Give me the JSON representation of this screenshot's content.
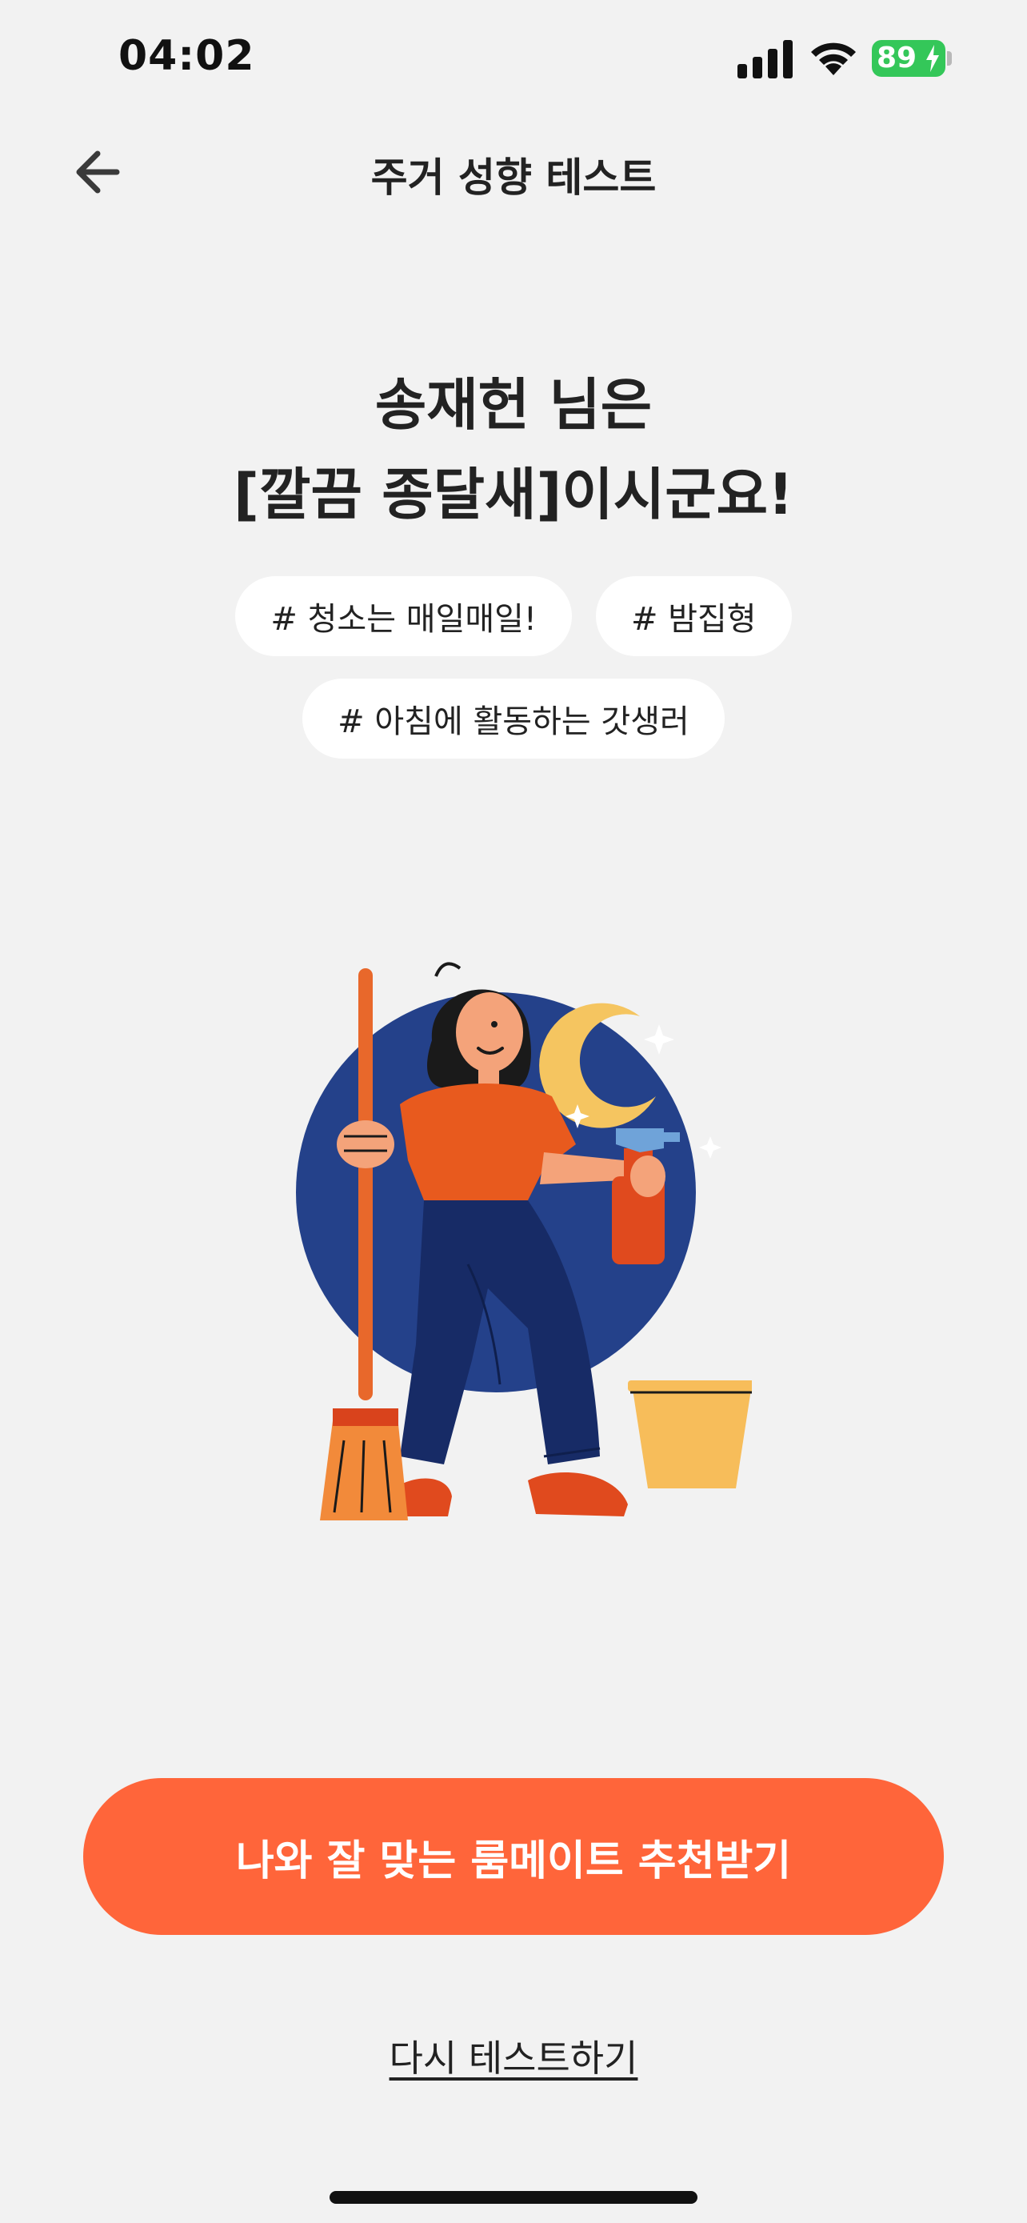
{
  "status_bar": {
    "time": "04:02",
    "battery_level": "89",
    "icons": [
      "signal-icon",
      "wifi-icon",
      "battery-charging-icon"
    ]
  },
  "header": {
    "title": "주거 성향 테스트",
    "back_icon": "arrow-left-icon"
  },
  "result": {
    "line1": "송재헌 님은",
    "line2": "[깔끔 종달새]이시군요!"
  },
  "tags": [
    "# 청소는 매일매일!",
    "# 밤집형",
    "# 아침에 활동하는 갓생러"
  ],
  "illustration": {
    "icon": "cleaning-woman-illustration"
  },
  "actions": {
    "recommend_label": "나와 잘 맞는 룸메이트 추천받기",
    "retry_label": "다시 테스트하기"
  },
  "colors": {
    "accent": "#ff653a",
    "background": "#f2f2f2",
    "battery": "#34c759"
  }
}
